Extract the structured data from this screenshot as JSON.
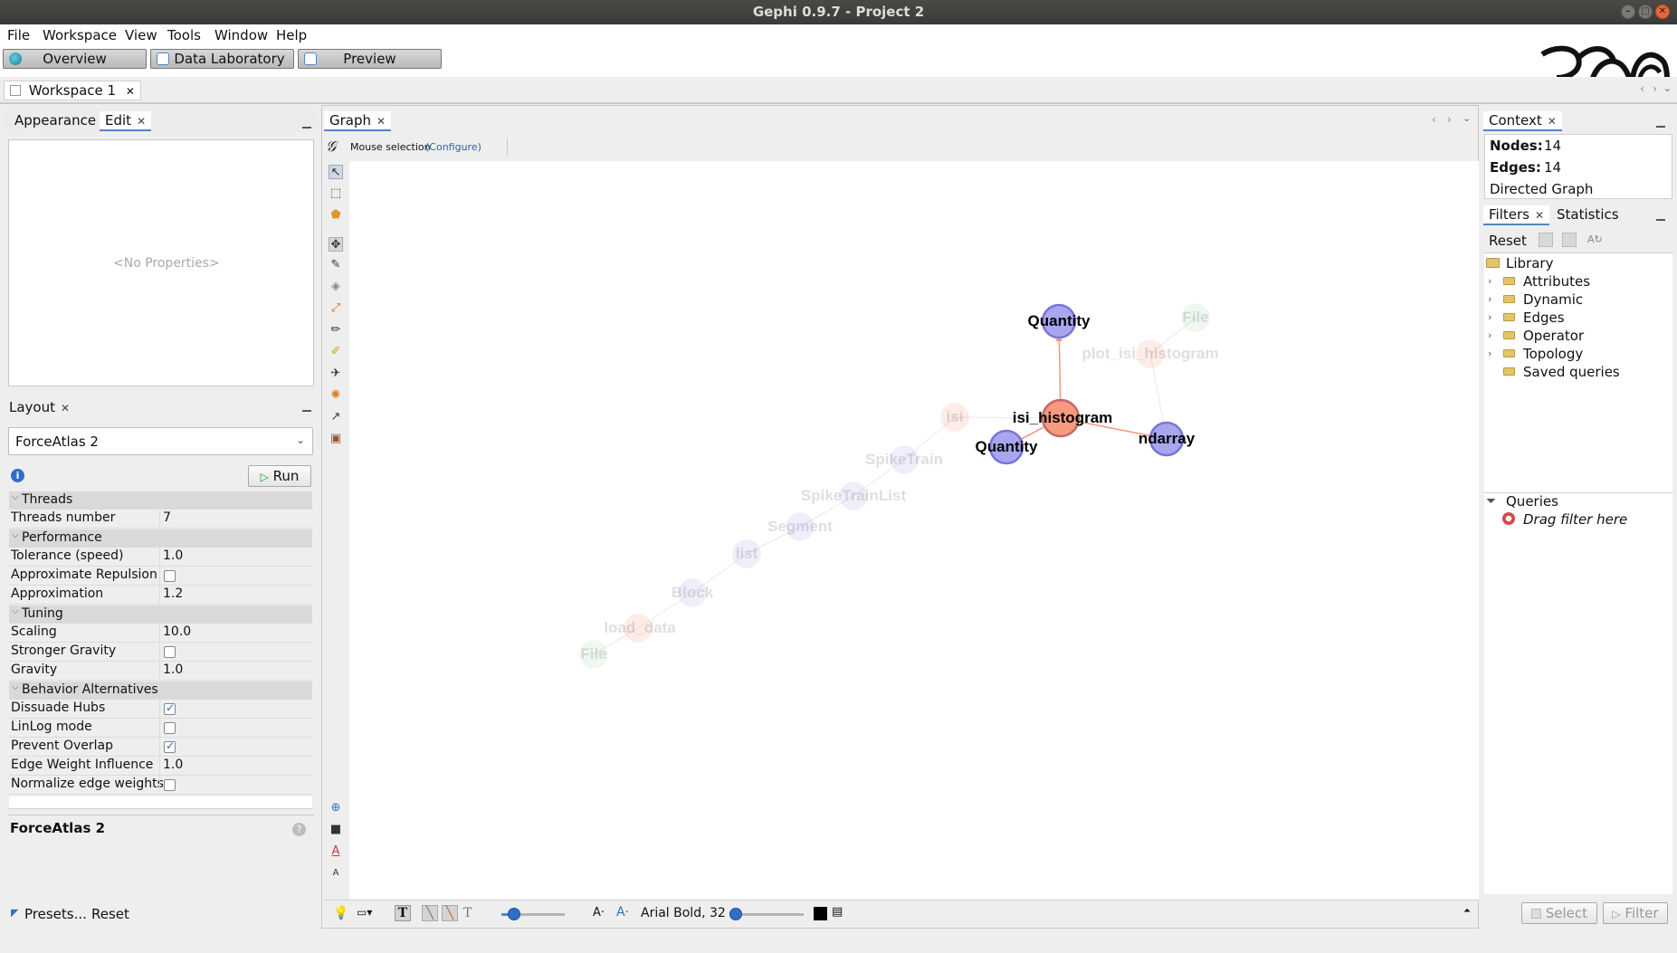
{
  "window": {
    "title": "Gephi 0.9.7 - Project 2"
  },
  "menu": [
    "File",
    "Workspace",
    "View",
    "Tools",
    "Window",
    "Help"
  ],
  "perspectives": {
    "overview": "Overview",
    "data_laboratory": "Data Laboratory",
    "preview": "Preview"
  },
  "workspace_tab": "Workspace 1",
  "left_top": {
    "tabs": [
      "Appearance",
      "Edit"
    ],
    "placeholder": "<No Properties>"
  },
  "layout": {
    "tab": "Layout",
    "algorithm": "ForceAtlas 2",
    "run_label": "Run",
    "categories": {
      "threads": "Threads",
      "performance": "Performance",
      "tuning": "Tuning",
      "behavior": "Behavior Alternatives"
    },
    "props": {
      "threads_number": {
        "name": "Threads number",
        "value": "7"
      },
      "tolerance": {
        "name": "Tolerance (speed)",
        "value": "1.0"
      },
      "approx_repulsion": {
        "name": "Approximate Repulsion",
        "checked": false
      },
      "approximation": {
        "name": "Approximation",
        "value": "1.2"
      },
      "scaling": {
        "name": "Scaling",
        "value": "10.0"
      },
      "stronger_gravity": {
        "name": "Stronger Gravity",
        "checked": false
      },
      "gravity": {
        "name": "Gravity",
        "value": "1.0"
      },
      "dissuade_hubs": {
        "name": "Dissuade Hubs",
        "checked": true
      },
      "linlog": {
        "name": "LinLog mode",
        "checked": false
      },
      "prevent_overlap": {
        "name": "Prevent Overlap",
        "checked": true
      },
      "edge_weight": {
        "name": "Edge Weight Influence",
        "value": "1.0"
      },
      "normalize": {
        "name": "Normalize edge weights",
        "checked": false
      }
    },
    "description_title": "ForceAtlas 2",
    "presets_label": "Presets...",
    "reset_label": "Reset"
  },
  "graph": {
    "tab": "Graph",
    "mode": "Mouse selection",
    "configure": "(Configure)",
    "font_label": "Arial Bold, 32",
    "nodes": [
      {
        "label": "Quantity",
        "color": "#a9a6ee",
        "faded": false
      },
      {
        "label": "isi_histogram",
        "color": "#f59a7e",
        "faded": false
      },
      {
        "label": "Quantity",
        "color": "#a9a6ee",
        "faded": false
      },
      {
        "label": "ndarray",
        "color": "#a9a6ee",
        "faded": false
      },
      {
        "label": "File",
        "color": "#a6dcb8",
        "faded": true
      },
      {
        "label": "plot_isi_histogram",
        "color": "#f59a7e",
        "faded": true
      },
      {
        "label": "isi",
        "color": "#f59a7e",
        "faded": true
      },
      {
        "label": "SpikeTrain",
        "color": "#a9a6ee",
        "faded": true
      },
      {
        "label": "SpikeTrainList",
        "color": "#a9a6ee",
        "faded": true
      },
      {
        "label": "Segment",
        "color": "#a9a6ee",
        "faded": true
      },
      {
        "label": "list",
        "color": "#a9a6ee",
        "faded": true
      },
      {
        "label": "Block",
        "color": "#a9a6ee",
        "faded": true
      },
      {
        "label": "load_data",
        "color": "#f59a7e",
        "faded": true
      },
      {
        "label": "File",
        "color": "#a6dcb8",
        "faded": true
      }
    ]
  },
  "context": {
    "tab": "Context",
    "nodes_label": "Nodes:",
    "nodes_value": "14",
    "edges_label": "Edges:",
    "edges_value": "14",
    "graph_type": "Directed Graph"
  },
  "filters": {
    "tabs": [
      "Filters",
      "Statistics"
    ],
    "reset": "Reset",
    "library": "Library",
    "categories": [
      "Attributes",
      "Dynamic",
      "Edges",
      "Operator",
      "Topology"
    ],
    "saved_queries": "Saved queries",
    "queries": "Queries",
    "drag_hint": "Drag filter here",
    "select_button": "Select",
    "filter_button": "Filter"
  },
  "colors": {
    "accent": "#4f86c6",
    "method_node": "#f59a7e",
    "class_node": "#a9a6ee",
    "file_node": "#a6dcb8"
  }
}
